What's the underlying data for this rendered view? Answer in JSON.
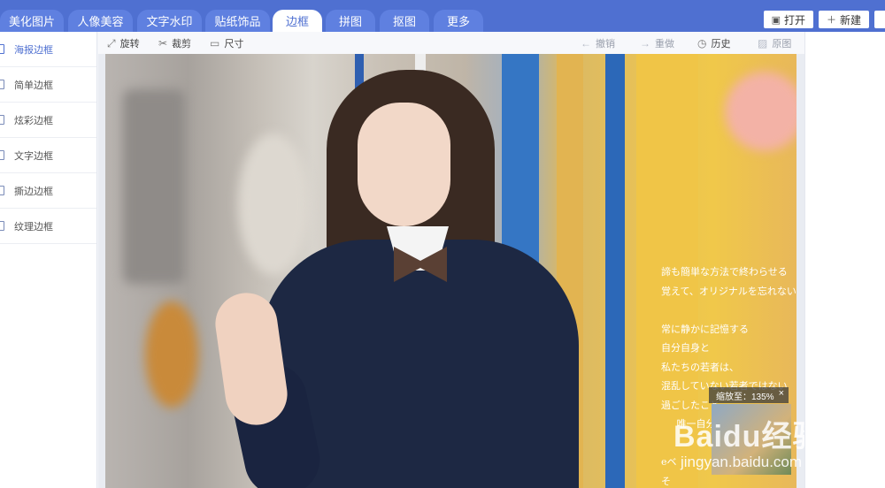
{
  "tabs": [
    {
      "label": "美化图片",
      "active": false
    },
    {
      "label": "人像美容",
      "active": false
    },
    {
      "label": "文字水印",
      "active": false
    },
    {
      "label": "贴纸饰品",
      "active": false
    },
    {
      "label": "边框",
      "active": true
    },
    {
      "label": "拼图",
      "active": false
    },
    {
      "label": "抠图",
      "active": false
    },
    {
      "label": "更多",
      "active": false
    }
  ],
  "top_actions": {
    "open_label": "打开",
    "new_label": "新建"
  },
  "sidebar": {
    "items": [
      {
        "label": "海报边框",
        "active": true
      },
      {
        "label": "简单边框",
        "active": false
      },
      {
        "label": "炫彩边框",
        "active": false
      },
      {
        "label": "文字边框",
        "active": false
      },
      {
        "label": "撕边边框",
        "active": false
      },
      {
        "label": "纹理边框",
        "active": false
      }
    ]
  },
  "toolbar": {
    "rotate": "旋转",
    "crop": "裁剪",
    "size": "尺寸",
    "undo": "撤销",
    "redo": "重做",
    "history": "历史",
    "original": "原图"
  },
  "canvas": {
    "overlay_text": "諦も簡単な方法で終わらせる\n覚えて、オリジナルを忘れない\n\n常に静かに記憶する\n自分自身と\n私たちの若者は、\n混乱していない若者ではない\n過ごしたこと\n     唯一自分の\n\neベ\nそ",
    "zoom_tip": "缩放至：135%",
    "zoom_close": "×",
    "watermark_logo": "Baidu经验",
    "watermark_url": "jingyan.baidu.com"
  },
  "colors": {
    "topbar": "#4f70d1",
    "tab": "#5f80e0",
    "accent": "#4f70d1"
  }
}
